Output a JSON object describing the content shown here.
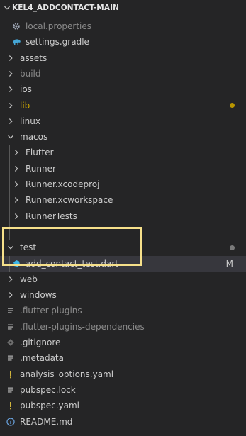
{
  "explorer": {
    "root_label": "KEL4_ADDCONTACT-MAIN",
    "items": [
      {
        "label": "local.properties",
        "kind": "file",
        "icon": "gear-icon",
        "depth": 1,
        "muted": true
      },
      {
        "label": "settings.gradle",
        "kind": "file",
        "icon": "gradle-elephant-icon",
        "depth": 1
      },
      {
        "label": "assets",
        "kind": "folder",
        "state": "collapsed",
        "depth": 0
      },
      {
        "label": "build",
        "kind": "folder",
        "state": "collapsed",
        "depth": 0,
        "muted": true
      },
      {
        "label": "ios",
        "kind": "folder",
        "state": "collapsed",
        "depth": 0
      },
      {
        "label": "lib",
        "kind": "folder",
        "state": "collapsed",
        "depth": 0,
        "color": "#cca700",
        "dot_color": "#b89500"
      },
      {
        "label": "linux",
        "kind": "folder",
        "state": "collapsed",
        "depth": 0
      },
      {
        "label": "macos",
        "kind": "folder",
        "state": "expanded",
        "depth": 0
      },
      {
        "label": "Flutter",
        "kind": "folder",
        "state": "collapsed",
        "depth": 1
      },
      {
        "label": "Runner",
        "kind": "folder",
        "state": "collapsed",
        "depth": 1
      },
      {
        "label": "Runner.xcodeproj",
        "kind": "folder",
        "state": "collapsed",
        "depth": 1
      },
      {
        "label": "Runner.xcworkspace",
        "kind": "folder",
        "state": "collapsed",
        "depth": 1
      },
      {
        "label": "RunnerTests",
        "kind": "folder",
        "state": "collapsed",
        "depth": 1
      },
      {
        "label": "",
        "kind": "hidden-row",
        "depth": 1
      },
      {
        "label": "test",
        "kind": "folder",
        "state": "expanded",
        "depth": 0,
        "dot_color": "#7a7a7a"
      },
      {
        "label": "add_contact_test.dart",
        "kind": "file",
        "icon": "dart-icon",
        "depth": 1,
        "badge": "M",
        "selected": true
      },
      {
        "label": "web",
        "kind": "folder",
        "state": "collapsed",
        "depth": 0
      },
      {
        "label": "windows",
        "kind": "folder",
        "state": "collapsed",
        "depth": 0
      },
      {
        "label": ".flutter-plugins",
        "kind": "file",
        "icon": "lines-icon",
        "depth": 0,
        "muted": true
      },
      {
        "label": ".flutter-plugins-dependencies",
        "kind": "file",
        "icon": "lines-icon",
        "depth": 0,
        "muted": true
      },
      {
        "label": ".gitignore",
        "kind": "file",
        "icon": "git-icon",
        "depth": 0
      },
      {
        "label": ".metadata",
        "kind": "file",
        "icon": "lines-icon",
        "depth": 0
      },
      {
        "label": "analysis_options.yaml",
        "kind": "file",
        "icon": "yaml-icon",
        "depth": 0
      },
      {
        "label": "pubspec.lock",
        "kind": "file",
        "icon": "lines-icon",
        "depth": 0
      },
      {
        "label": "pubspec.yaml",
        "kind": "file",
        "icon": "yaml-icon",
        "depth": 0
      },
      {
        "label": "README.md",
        "kind": "file",
        "icon": "info-icon",
        "depth": 0
      }
    ]
  },
  "colors": {
    "background": "#252526",
    "selected_row": "#37373d",
    "highlight_border": "#f6e08a",
    "dart_icon": "#40b8e8",
    "yaml_icon": "#d0b43c",
    "info_icon": "#6aa4e0",
    "gitignore_icon": "#8a8a8a",
    "gradle_icon": "#45a6d6"
  }
}
